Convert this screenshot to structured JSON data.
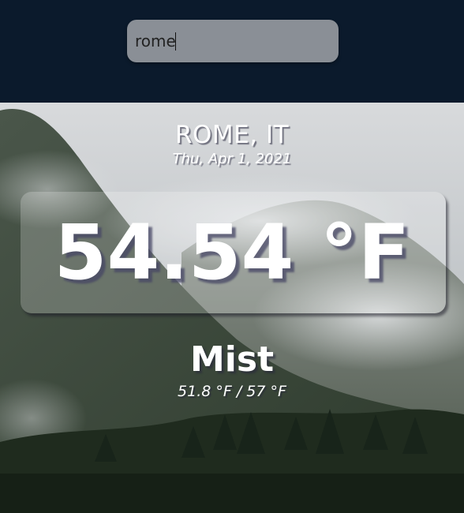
{
  "search": {
    "value": "rome"
  },
  "weather": {
    "location": "ROME, IT",
    "date": "Thu, Apr 1, 2021",
    "temperature": "54.54 °F",
    "condition": "Mist",
    "range": "51.8 °F / 57 °F"
  },
  "colors": {
    "header_bg": "#0b1a2c",
    "search_bg": "#8a8f96"
  },
  "background": "misty-forest-mountain-photo"
}
